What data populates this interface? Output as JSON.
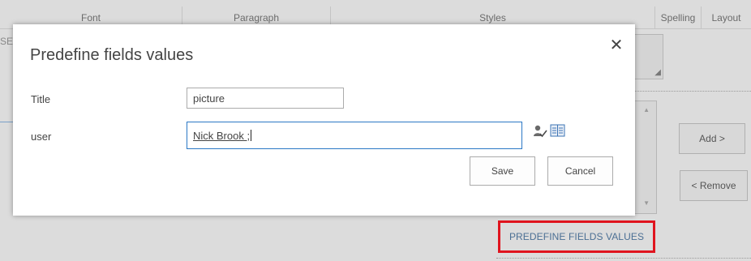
{
  "ribbon": {
    "groups": [
      "Font",
      "Paragraph",
      "Styles",
      "Spelling",
      "Layout"
    ]
  },
  "background": {
    "left_stub_text": "SE",
    "add_button": "Add >",
    "remove_button": "< Remove",
    "predefine_link": "PREDEFINE FIELDS VALUES",
    "highlight_color": "#e0141e"
  },
  "dialog": {
    "title": "Predefine fields values",
    "close_glyph": "✕",
    "fields": {
      "title_label": "Title",
      "title_value": "picture",
      "user_label": "user",
      "user_value": "Nick Brook ;"
    },
    "buttons": {
      "save": "Save",
      "cancel": "Cancel"
    },
    "icons": {
      "check_names": "check-names-icon",
      "browse": "address-book-icon"
    }
  }
}
